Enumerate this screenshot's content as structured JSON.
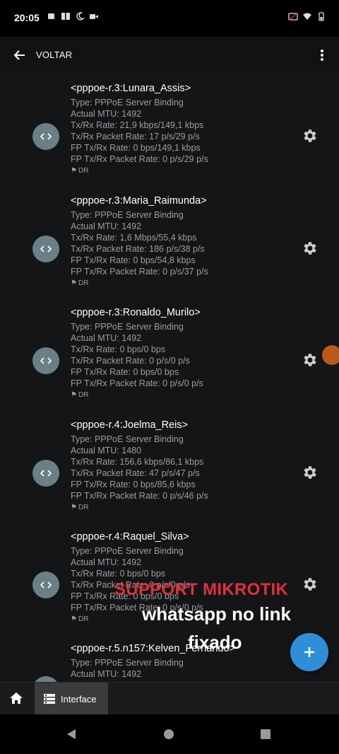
{
  "status": {
    "time": "20:05"
  },
  "app_bar": {
    "back_label": "VOLTAR"
  },
  "items": [
    {
      "name": "<pppoe-r.3:Lunara_Assis>",
      "lines": [
        "Type: PPPoE Server Binding",
        "Actual MTU: 1492",
        "Tx/Rx Rate: 21,9 kbps/149,1 kbps",
        "Tx/Rx Packet Rate: 17 p/s/29 p/s",
        "FP Tx/Rx Rate: 0 bps/149,1 kbps",
        "FP Tx/Rx Packet Rate: 0 p/s/29 p/s"
      ],
      "flag": "DR"
    },
    {
      "name": "<pppoe-r.3:Maria_Raimunda>",
      "lines": [
        "Type: PPPoE Server Binding",
        "Actual MTU: 1492",
        "Tx/Rx Rate: 1,6 Mbps/55,4 kbps",
        "Tx/Rx Packet Rate: 186 p/s/38 p/s",
        "FP Tx/Rx Rate: 0 bps/54,8 kbps",
        "FP Tx/Rx Packet Rate: 0 p/s/37 p/s"
      ],
      "flag": "DR"
    },
    {
      "name": "<pppoe-r.3:Ronaldo_Murilo>",
      "lines": [
        "Type: PPPoE Server Binding",
        "Actual MTU: 1492",
        "Tx/Rx Rate: 0 bps/0 bps",
        "Tx/Rx Packet Rate: 0 p/s/0 p/s",
        "FP Tx/Rx Rate: 0 bps/0 bps",
        "FP Tx/Rx Packet Rate: 0 p/s/0 p/s"
      ],
      "flag": "DR"
    },
    {
      "name": "<pppoe-r.4:Joelma_Reis>",
      "lines": [
        "Type: PPPoE Server Binding",
        "Actual MTU: 1480",
        "Tx/Rx Rate: 156,6 kbps/86,1 kbps",
        "Tx/Rx Packet Rate: 47 p/s/47 p/s",
        "FP Tx/Rx Rate: 0 bps/85,6 kbps",
        "FP Tx/Rx Packet Rate: 0 p/s/46 p/s"
      ],
      "flag": "DR"
    },
    {
      "name": "<pppoe-r.4:Raquel_Silva>",
      "lines": [
        "Type: PPPoE Server Binding",
        "Actual MTU: 1492",
        "Tx/Rx Rate: 0 bps/0 bps",
        "Tx/Rx Packet Rate: 0 p/s/0 p/s",
        "FP Tx/Rx Rate: 0 bps/0 bps",
        "FP Tx/Rx Packet Rate: 0 p/s/0 p/s"
      ],
      "flag": "DR"
    },
    {
      "name": "<pppoe-r.5.n157:Kelven_Fernando>",
      "lines": [
        "Type: PPPoE Server Binding",
        "Actual MTU: 1492"
      ],
      "flag": ""
    }
  ],
  "overlay": {
    "title": "SUPPORT MIKROTIK",
    "line1": "whatsapp no link",
    "line2": "fixado"
  },
  "bottom_bar": {
    "tab_label": "Interface"
  },
  "colors": {
    "fab": "#2e8fd8",
    "overlay_title": "#e0303c",
    "avatar": "#6b8086"
  }
}
